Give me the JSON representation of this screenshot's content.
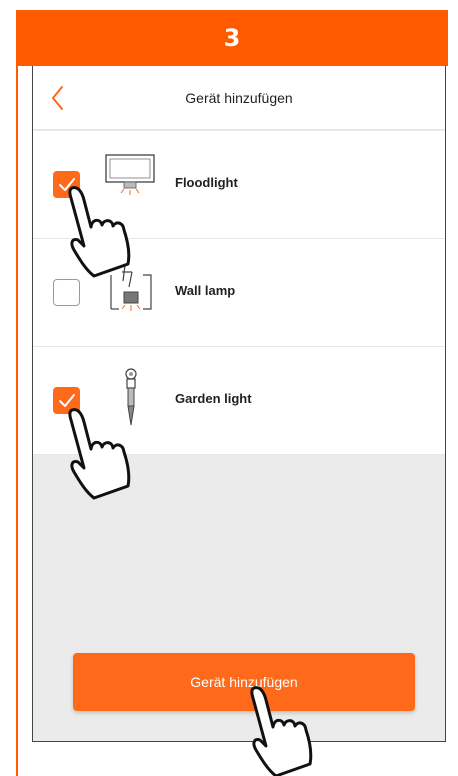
{
  "step": {
    "number": "3",
    "accent_color": "#ff5a00"
  },
  "nav": {
    "title": "Gerät hinzufügen",
    "back_icon": "chevron-left-icon"
  },
  "devices": [
    {
      "label": "Floodlight",
      "checked": true,
      "icon": "floodlight-icon"
    },
    {
      "label": "Wall lamp",
      "checked": false,
      "icon": "wall-lamp-icon"
    },
    {
      "label": "Garden light",
      "checked": true,
      "icon": "garden-light-icon"
    }
  ],
  "action": {
    "label": "Gerät hinzufügen",
    "color": "#ff6a1a"
  },
  "gesture_icon": "tap-hand-icon"
}
